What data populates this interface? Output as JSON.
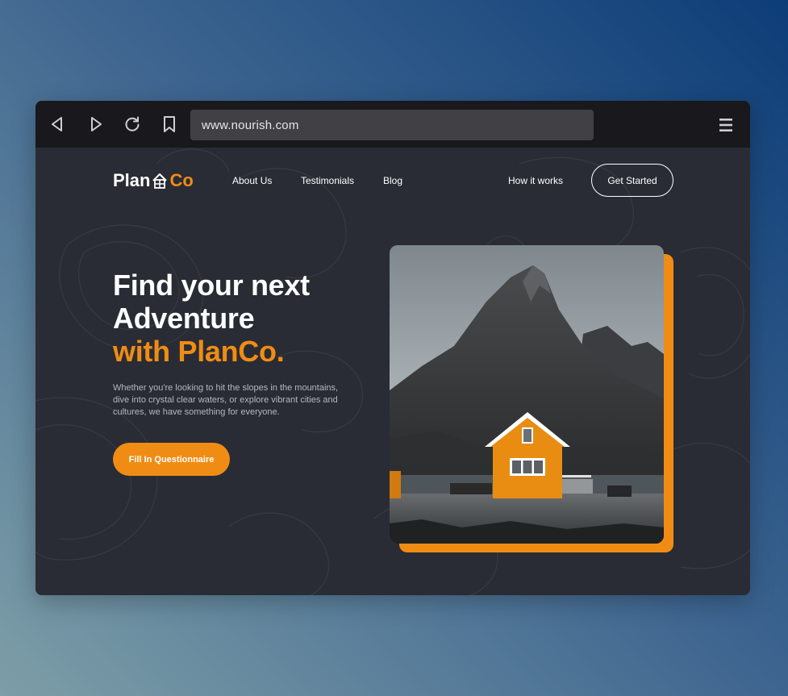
{
  "browser": {
    "url": "www.nourish.com",
    "icons": [
      "back-icon",
      "forward-icon",
      "reload-icon",
      "bookmark-icon",
      "menu-icon"
    ]
  },
  "site": {
    "logo": {
      "part1": "Plan",
      "part2": "Co",
      "icon": "house-icon"
    },
    "nav": {
      "about": "About Us",
      "testimonials": "Testimonials",
      "blog": "Blog",
      "how": "How it works",
      "cta": "Get Started"
    },
    "hero": {
      "line1": "Find your next",
      "line2": "Adventure",
      "line3": "with PlanCo.",
      "description": "Whether you're looking to hit the slopes in the mountains, dive into crystal clear waters, or explore vibrant cities and cultures, we have something for everyone.",
      "cta": "Fill In Questionnaire"
    }
  },
  "colors": {
    "accent": "#f08c14",
    "page_bg": "#292c34",
    "chrome_bg": "#19181d",
    "url_bg": "#414145"
  }
}
